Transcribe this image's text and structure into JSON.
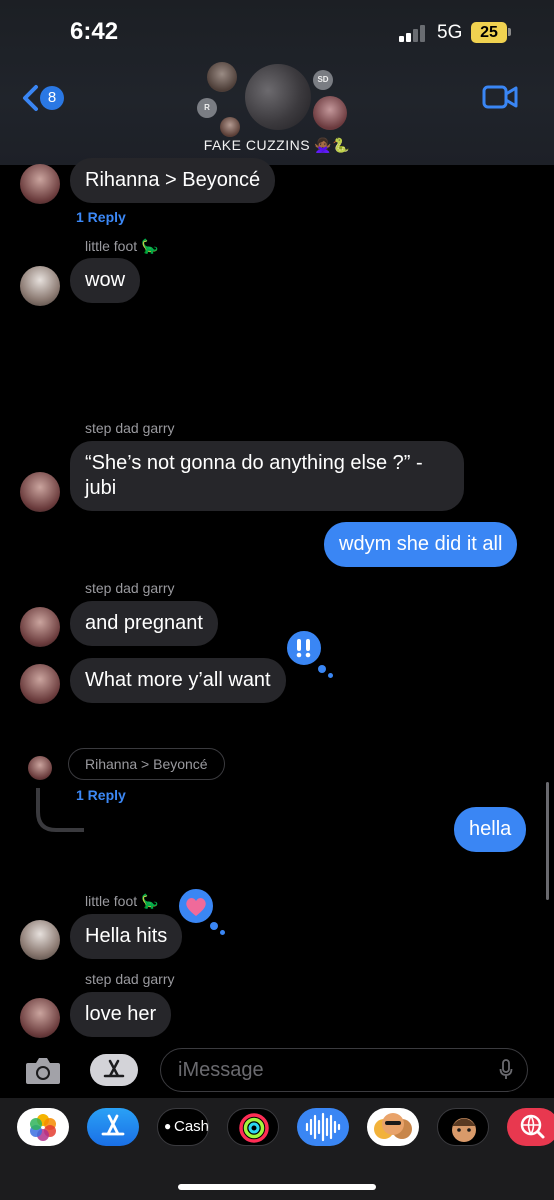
{
  "status": {
    "time": "6:42",
    "network": "5G",
    "battery": "25"
  },
  "header": {
    "back_count": "8",
    "group_name": "FAKE CUZZINS 🙅🏾‍♀️🐍",
    "avatar_initials": [
      "R",
      "SD"
    ]
  },
  "messages": [
    {
      "text": "Rihanna > Beyoncé"
    },
    {
      "replies": "1 Reply"
    },
    {
      "sender": "little foot 🦕",
      "text": "wow"
    },
    {
      "sender": "step dad garry",
      "line1": "“She’s not gonna do anything else ?” -",
      "line2": "jubi"
    },
    {
      "text": "wdym she did it all"
    },
    {
      "sender": "step dad garry",
      "text": "and pregnant"
    },
    {
      "text": "What more y’all want",
      "tapback": "‼️"
    },
    {
      "quoted": "Rihanna > Beyoncé",
      "replies": "1 Reply"
    },
    {
      "text": "hella"
    },
    {
      "sender": "little foot 🦕",
      "text": "Hella hits",
      "tapback": "heart"
    },
    {
      "sender": "step dad garry",
      "text": "love her"
    }
  ],
  "input": {
    "placeholder": "iMessage"
  },
  "apps": [
    {
      "name": "Photos"
    },
    {
      "name": "App Store"
    },
    {
      "name": "Cash",
      "label": "Cash"
    },
    {
      "name": "Activity"
    },
    {
      "name": "Audio"
    },
    {
      "name": "Memoji Stickers"
    },
    {
      "name": "Memoji"
    },
    {
      "name": "Search"
    }
  ],
  "colors": {
    "incoming_bubble": "#26262a",
    "outgoing_bubble": "#3a86f4",
    "link": "#3c88f6",
    "battery": "#f0d250"
  }
}
